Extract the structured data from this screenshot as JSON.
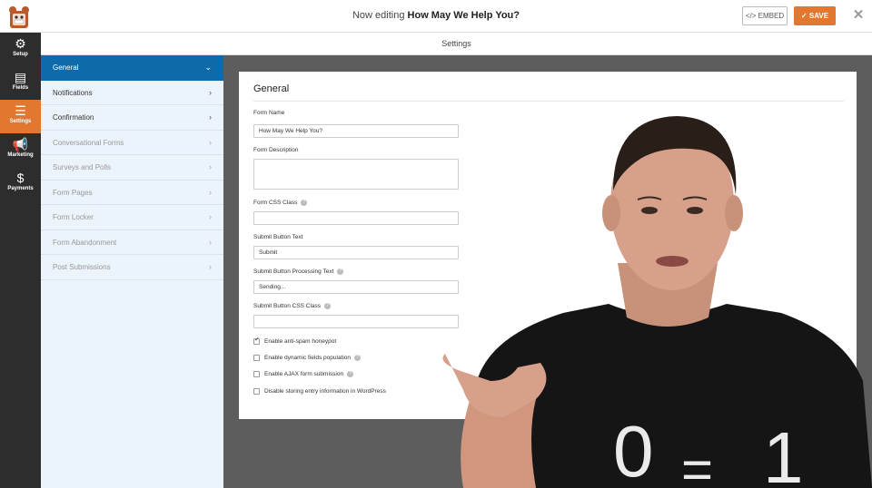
{
  "header": {
    "editing_prefix": "Now editing",
    "form_title": "How May We Help You?",
    "embed_label": "EMBED",
    "embed_icon": "code-icon",
    "save_label": "SAVE",
    "save_icon": "check-icon",
    "close_glyph": "✕"
  },
  "rail": {
    "items": [
      {
        "label": "Setup",
        "icon": "gear-icon",
        "glyph": "⚙"
      },
      {
        "label": "Fields",
        "icon": "fields-icon",
        "glyph": "▤"
      },
      {
        "label": "Settings",
        "icon": "sliders-icon",
        "glyph": "☰"
      },
      {
        "label": "Marketing",
        "icon": "megaphone-icon",
        "glyph": "📢"
      },
      {
        "label": "Payments",
        "icon": "dollar-icon",
        "glyph": "$"
      }
    ]
  },
  "settings_bar": {
    "title": "Settings"
  },
  "subnav": {
    "items": [
      {
        "label": "General",
        "chev": "⌄"
      },
      {
        "label": "Notifications",
        "chev": "›"
      },
      {
        "label": "Confirmation",
        "chev": "›"
      },
      {
        "label": "Conversational Forms",
        "chev": "›"
      },
      {
        "label": "Surveys and Polls",
        "chev": "›"
      },
      {
        "label": "Form Pages",
        "chev": "›"
      },
      {
        "label": "Form Locker",
        "chev": "›"
      },
      {
        "label": "Form Abandonment",
        "chev": "›"
      },
      {
        "label": "Post Submissions",
        "chev": "›"
      }
    ]
  },
  "panel": {
    "title": "General",
    "form_name_label": "Form Name",
    "form_name_value": "How May We Help You?",
    "form_description_label": "Form Description",
    "form_description_value": "",
    "css_class_label": "Form CSS Class",
    "css_class_value": "",
    "submit_text_label": "Submit Button Text",
    "submit_text_value": "Submit",
    "processing_text_label": "Submit Button Processing Text",
    "processing_text_value": "Sending...",
    "submit_css_label": "Submit Button CSS Class",
    "submit_css_value": "",
    "help_glyph": "?",
    "checkboxes": [
      {
        "label": "Enable anti-spam honeypot",
        "checked": true
      },
      {
        "label": "Enable dynamic fields population",
        "checked": false
      },
      {
        "label": "Enable AJAX form submission",
        "checked": false
      },
      {
        "label": "Disable storing entry information in WordPress",
        "checked": false
      }
    ]
  },
  "overlay": {
    "shirt_text_top": "0",
    "shirt_text_mid": "=",
    "shirt_text_right": "1"
  },
  "colors": {
    "accent": "#e27730",
    "active_blue": "#0e6aa8",
    "rail_bg": "#2d2d2d"
  }
}
